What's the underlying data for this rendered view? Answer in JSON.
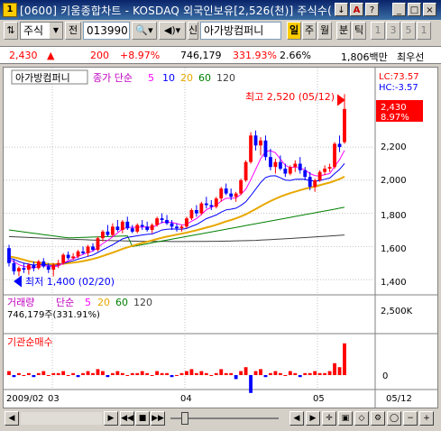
{
  "window": {
    "app_badge": "1",
    "title": "[0600] 키움종합차트 - KOSDAQ 외국인보유[2,526(천)] 주식수(",
    "controls": [
      "↓",
      "A",
      "?",
      "_",
      "□",
      "×"
    ]
  },
  "toolbar": {
    "market": "주식",
    "prev_label": "전",
    "code": "013990",
    "stock_name": "아가방컴퍼니",
    "new_label": "신",
    "periods": [
      "일",
      "주",
      "월"
    ],
    "minute_label": "분",
    "tick_label": "틱",
    "numbers": [
      "1",
      "3",
      "5",
      "1"
    ]
  },
  "quote": {
    "price": "2,430",
    "change_arrow": "▲",
    "change": "200",
    "change_pct": "+8.97%",
    "volume": "746,179",
    "volume_ratio": "331.93%",
    "turnover": "2.66%",
    "amount": "1,806백만",
    "extra": "최우선"
  },
  "legend": {
    "stock_name": "아가방컴퍼니",
    "ma_label": "종가 단순",
    "ma_periods": [
      "5",
      "10",
      "20",
      "60",
      "120"
    ],
    "lc": "LC:73.57",
    "hc": "HC:-3.57",
    "high_note": "최고 2,520 (05/12)",
    "low_note": "최저 1,400 (02/20)",
    "last_price": "2,430",
    "last_pct": "8.97%"
  },
  "volume_panel": {
    "label": "거래량",
    "ma_label": "단순",
    "ma_periods": [
      "5",
      "20",
      "60",
      "120"
    ],
    "current": "746,179주(331.91%)",
    "axis_tick": "2,500K"
  },
  "inst_panel": {
    "label": "기관순매수",
    "axis_tick": "0"
  },
  "axis": {
    "x_labels": [
      "2009/02",
      "03",
      "04",
      "05",
      "05/12"
    ],
    "y_labels": [
      "2,200",
      "2,000",
      "1,800",
      "1,600",
      "1,400"
    ]
  },
  "colors": {
    "up": "#ff0000",
    "down": "#0000ff",
    "ma5": "#ff00ff",
    "ma10": "#0000ff",
    "ma20": "#e8a800",
    "ma60": "#008000",
    "ma120": "#404040"
  },
  "chart_data": {
    "type": "candlestick",
    "ohlc": [
      [
        1590,
        1610,
        1480,
        1500
      ],
      [
        1500,
        1520,
        1430,
        1450
      ],
      [
        1450,
        1480,
        1420,
        1470
      ],
      [
        1470,
        1500,
        1440,
        1460
      ],
      [
        1460,
        1500,
        1430,
        1490
      ],
      [
        1490,
        1510,
        1450,
        1470
      ],
      [
        1470,
        1520,
        1460,
        1510
      ],
      [
        1510,
        1530,
        1470,
        1480
      ],
      [
        1480,
        1500,
        1440,
        1460
      ],
      [
        1460,
        1500,
        1420,
        1490
      ],
      [
        1490,
        1520,
        1470,
        1500
      ],
      [
        1500,
        1560,
        1490,
        1550
      ],
      [
        1550,
        1570,
        1520,
        1530
      ],
      [
        1530,
        1560,
        1520,
        1540
      ],
      [
        1540,
        1580,
        1530,
        1570
      ],
      [
        1570,
        1600,
        1550,
        1560
      ],
      [
        1560,
        1610,
        1540,
        1600
      ],
      [
        1600,
        1620,
        1570,
        1580
      ],
      [
        1580,
        1660,
        1570,
        1650
      ],
      [
        1650,
        1700,
        1630,
        1690
      ],
      [
        1690,
        1730,
        1660,
        1670
      ],
      [
        1670,
        1740,
        1660,
        1720
      ],
      [
        1720,
        1760,
        1690,
        1700
      ],
      [
        1700,
        1760,
        1680,
        1750
      ],
      [
        1750,
        1780,
        1700,
        1710
      ],
      [
        1710,
        1730,
        1680,
        1690
      ],
      [
        1690,
        1740,
        1680,
        1730
      ],
      [
        1730,
        1760,
        1700,
        1720
      ],
      [
        1720,
        1750,
        1690,
        1700
      ],
      [
        1700,
        1740,
        1680,
        1730
      ],
      [
        1730,
        1780,
        1720,
        1770
      ],
      [
        1770,
        1800,
        1740,
        1760
      ],
      [
        1760,
        1790,
        1730,
        1740
      ],
      [
        1740,
        1760,
        1700,
        1720
      ],
      [
        1720,
        1740,
        1690,
        1710
      ],
      [
        1710,
        1730,
        1690,
        1720
      ],
      [
        1720,
        1780,
        1710,
        1770
      ],
      [
        1770,
        1830,
        1760,
        1820
      ],
      [
        1820,
        1850,
        1780,
        1800
      ],
      [
        1800,
        1870,
        1790,
        1860
      ],
      [
        1860,
        1900,
        1830,
        1850
      ],
      [
        1850,
        1880,
        1820,
        1840
      ],
      [
        1840,
        1900,
        1830,
        1890
      ],
      [
        1890,
        1960,
        1870,
        1950
      ],
      [
        1950,
        1980,
        1910,
        1920
      ],
      [
        1920,
        1950,
        1880,
        1900
      ],
      [
        1900,
        1930,
        1870,
        1920
      ],
      [
        1920,
        2010,
        1910,
        2000
      ],
      [
        2000,
        2120,
        1990,
        2110
      ],
      [
        2110,
        2290,
        2100,
        2270
      ],
      [
        2270,
        2300,
        2180,
        2210
      ],
      [
        2210,
        2260,
        2150,
        2240
      ],
      [
        2240,
        2270,
        2120,
        2140
      ],
      [
        2140,
        2190,
        2060,
        2080
      ],
      [
        2080,
        2130,
        2040,
        2110
      ],
      [
        2110,
        2150,
        2060,
        2070
      ],
      [
        2070,
        2100,
        2020,
        2040
      ],
      [
        2040,
        2090,
        2030,
        2080
      ],
      [
        2080,
        2120,
        2050,
        2100
      ],
      [
        2100,
        2140,
        2040,
        2060
      ],
      [
        2060,
        2080,
        2000,
        2020
      ],
      [
        2020,
        2050,
        1940,
        1960
      ],
      [
        1960,
        2010,
        1930,
        2000
      ],
      [
        2000,
        2060,
        1990,
        2050
      ],
      [
        2050,
        2090,
        2030,
        2070
      ],
      [
        2070,
        2100,
        2050,
        2080
      ],
      [
        2080,
        2230,
        2070,
        2220
      ],
      [
        2220,
        2270,
        2170,
        2200
      ],
      [
        2230,
        2520,
        2220,
        2430
      ]
    ],
    "ma5": [
      1520,
      1510,
      1490,
      1480,
      1475,
      1470,
      1480,
      1485,
      1480,
      1478,
      1482,
      1500,
      1515,
      1525,
      1540,
      1553,
      1563,
      1573,
      1595,
      1618,
      1637,
      1658,
      1682,
      1706,
      1715,
      1716,
      1716,
      1718,
      1718,
      1714,
      1729,
      1746,
      1748,
      1746,
      1738,
      1730,
      1734,
      1753,
      1768,
      1794,
      1822,
      1836,
      1850,
      1874,
      1891,
      1891,
      1893,
      1915,
      1946,
      2004,
      2066,
      2130,
      2174,
      2178,
      2166,
      2128,
      2090,
      2076,
      2080,
      2072,
      2063,
      2040,
      2028,
      2026,
      2034,
      2040,
      2084,
      2124,
      2180
    ],
    "ma20": [
      1540,
      1535,
      1528,
      1520,
      1512,
      1506,
      1502,
      1498,
      1495,
      1494,
      1494,
      1496,
      1499,
      1503,
      1507,
      1512,
      1518,
      1525,
      1533,
      1543,
      1553,
      1563,
      1574,
      1585,
      1595,
      1604,
      1613,
      1621,
      1629,
      1637,
      1645,
      1653,
      1660,
      1666,
      1672,
      1678,
      1684,
      1691,
      1698,
      1706,
      1714,
      1722,
      1731,
      1741,
      1751,
      1760,
      1770,
      1781,
      1794,
      1810,
      1826,
      1843,
      1859,
      1874,
      1888,
      1901,
      1912,
      1922,
      1931,
      1940,
      1948,
      1955,
      1962,
      1970,
      1978,
      1986,
      1996,
      2007,
      2022
    ],
    "ma60_range": [
      1700,
      1840
    ],
    "ma120_range": [
      1630,
      1650
    ],
    "volume": [
      40,
      60,
      30,
      35,
      45,
      30,
      40,
      35,
      30,
      50,
      40,
      70,
      45,
      40,
      55,
      35,
      60,
      45,
      90,
      110,
      70,
      85,
      65,
      80,
      60,
      45,
      55,
      50,
      40,
      50,
      70,
      60,
      55,
      45,
      40,
      40,
      75,
      120,
      80,
      95,
      70,
      60,
      85,
      140,
      90,
      65,
      70,
      160,
      260,
      420,
      220,
      180,
      150,
      130,
      110,
      100,
      90,
      85,
      95,
      100,
      80,
      110,
      90,
      95,
      85,
      80,
      260,
      300,
      560
    ],
    "inst": [
      2,
      -1,
      1,
      0,
      1,
      -1,
      1,
      2,
      0,
      1,
      1,
      2,
      0,
      1,
      -1,
      1,
      2,
      1,
      3,
      2,
      -1,
      1,
      2,
      1,
      0,
      1,
      1,
      2,
      1,
      0,
      2,
      1,
      1,
      -1,
      0,
      1,
      2,
      3,
      1,
      2,
      1,
      0,
      1,
      3,
      1,
      1,
      -2,
      2,
      4,
      -9,
      2,
      3,
      -1,
      1,
      2,
      1,
      0,
      2,
      1,
      -1,
      1,
      1,
      2,
      1,
      1,
      2,
      6,
      4,
      16
    ],
    "ylim": [
      1330,
      2560
    ]
  }
}
